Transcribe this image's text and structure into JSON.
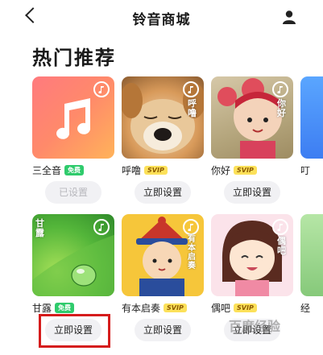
{
  "header": {
    "title": "铃音商城",
    "back_icon": "back-chevron-icon",
    "user_icon": "user-icon"
  },
  "section": {
    "title": "热门推荐"
  },
  "ringtones": [
    {
      "name": "三全音",
      "badge": "免费",
      "badge_type": "free",
      "button": "已设置",
      "button_state": "disabled",
      "cover_text": ""
    },
    {
      "name": "呼噜",
      "badge": "SVIP",
      "badge_type": "svip",
      "button": "立即设置",
      "button_state": "enabled",
      "cover_text": "呼噜"
    },
    {
      "name": "你好",
      "badge": "SVIP",
      "badge_type": "svip",
      "button": "立即设置",
      "button_state": "enabled",
      "cover_text": "你好"
    },
    {
      "name": "叮",
      "badge": "",
      "badge_type": "",
      "button": "",
      "button_state": "",
      "cover_text": ""
    },
    {
      "name": "甘露",
      "badge": "免费",
      "badge_type": "free",
      "button": "立即设置",
      "button_state": "enabled",
      "cover_text": "甘露"
    },
    {
      "name": "有本启奏",
      "badge": "SVIP",
      "badge_type": "svip",
      "button": "立即设置",
      "button_state": "enabled",
      "cover_text": "有本启奏"
    },
    {
      "name": "偶吧",
      "badge": "SVIP",
      "badge_type": "svip",
      "button": "立即设置",
      "button_state": "enabled",
      "cover_text": "偶吧"
    },
    {
      "name": "经",
      "badge": "",
      "badge_type": "",
      "button": "",
      "button_state": "",
      "cover_text": ""
    }
  ],
  "colors": {
    "highlight": "#d51c1c",
    "free_badge": "#2fcb6c",
    "svip_badge": "#fce15a"
  },
  "watermark": "百度经验"
}
